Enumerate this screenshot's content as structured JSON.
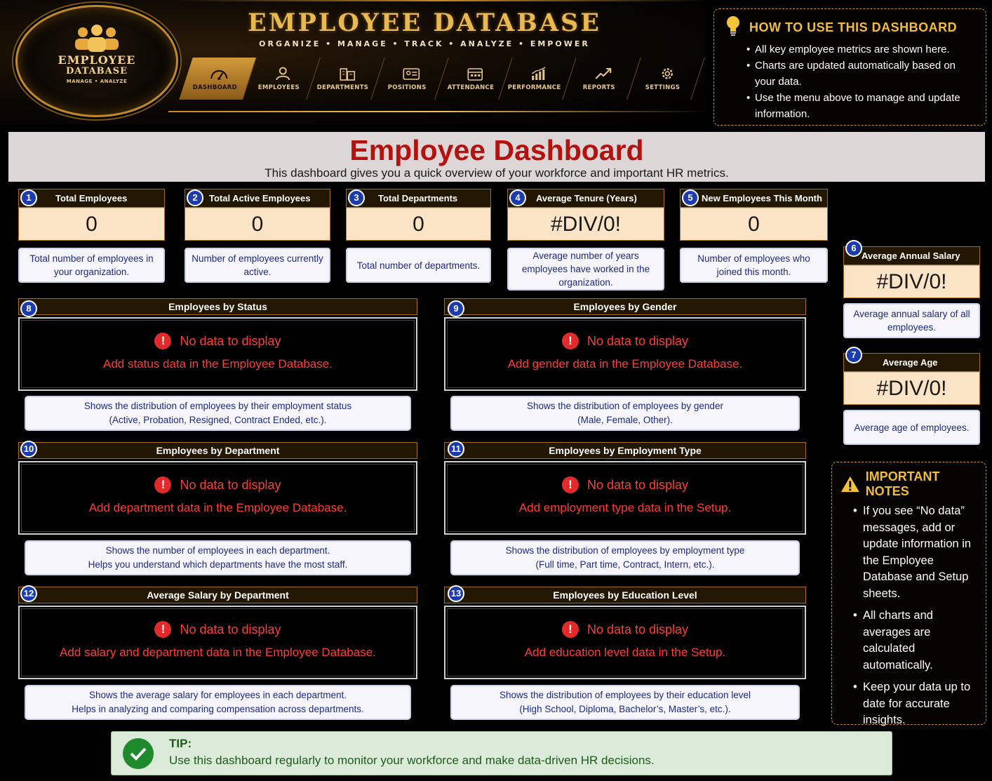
{
  "header": {
    "logo": {
      "line1": "EMPLOYEE",
      "line2": "DATABASE",
      "line3": "MANAGE • ANALYZE"
    },
    "title": "EMPLOYEE DATABASE",
    "subtitle": "ORGANIZE • MANAGE • TRACK • ANALYZE • EMPOWER",
    "nav": [
      {
        "label": "DASHBOARD",
        "icon": "gauge-icon",
        "active": true
      },
      {
        "label": "EMPLOYEES",
        "icon": "person-icon",
        "active": false
      },
      {
        "label": "DEPARTMENTS",
        "icon": "building-icon",
        "active": false
      },
      {
        "label": "POSITIONS",
        "icon": "id-card-icon",
        "active": false
      },
      {
        "label": "ATTENDANCE",
        "icon": "calendar-icon",
        "active": false
      },
      {
        "label": "PERFORMANCE",
        "icon": "bar-chart-icon",
        "active": false
      },
      {
        "label": "REPORTS",
        "icon": "trend-icon",
        "active": false
      },
      {
        "label": "SETTINGS",
        "icon": "gear-icon",
        "active": false
      }
    ]
  },
  "howto": {
    "title": "HOW TO USE THIS DASHBOARD",
    "items": [
      "All key employee metrics are shown here.",
      "Charts are updated automatically based on your data.",
      "Use the menu above to manage and update information."
    ]
  },
  "banner": {
    "title": "Employee Dashboard",
    "subtitle": "This dashboard gives you a quick overview of your workforce and important HR metrics."
  },
  "kpis": [
    {
      "num": "1",
      "title": "Total Employees",
      "value": "0",
      "desc": "Total number of employees in your organization."
    },
    {
      "num": "2",
      "title": "Total Active Employees",
      "value": "0",
      "desc": "Number of employees currently active."
    },
    {
      "num": "3",
      "title": "Total Departments",
      "value": "0",
      "desc": "Total number of departments."
    },
    {
      "num": "4",
      "title": "Average Tenure (Years)",
      "value": "#DIV/0!",
      "desc": "Average number of years employees have worked in the organization."
    },
    {
      "num": "5",
      "title": "New Employees This Month",
      "value": "0",
      "desc": "Number of employees who joined this month."
    },
    {
      "num": "6",
      "title": "Average Annual Salary",
      "value": "#DIV/0!",
      "desc": "Average annual salary of all employees."
    },
    {
      "num": "7",
      "title": "Average Age",
      "value": "#DIV/0!",
      "desc": "Average age of employees."
    }
  ],
  "panels": [
    {
      "num": "8",
      "title": "Employees by Status",
      "nodata": "No data to display",
      "hint": "Add status data in the Employee Database.",
      "desc1": "Shows the distribution of employees by their employment status",
      "desc2": "(Active, Probation, Resigned, Contract Ended, etc.)."
    },
    {
      "num": "9",
      "title": "Employees by Gender",
      "nodata": "No data to display",
      "hint": "Add gender data in the Employee Database.",
      "desc1": "Shows the distribution of employees by gender",
      "desc2": "(Male, Female, Other)."
    },
    {
      "num": "10",
      "title": "Employees by Department",
      "nodata": "No data to display",
      "hint": "Add department data in the Employee Database.",
      "desc1": "Shows the number of employees in each department.",
      "desc2": "Helps you understand which departments have the most staff."
    },
    {
      "num": "11",
      "title": "Employees by Employment Type",
      "nodata": "No data to display",
      "hint": "Add employment type data in the Setup.",
      "desc1": "Shows the distribution of employees by employment type",
      "desc2": "(Full time, Part time, Contract, Intern, etc.)."
    },
    {
      "num": "12",
      "title": "Average Salary by Department",
      "nodata": "No data to display",
      "hint": "Add salary and department data in the Employee Database.",
      "desc1": "Shows the average salary for employees in each department.",
      "desc2": "Helps in analyzing and comparing compensation across departments."
    },
    {
      "num": "13",
      "title": "Employees by Education Level",
      "nodata": "No data to display",
      "hint": "Add education level data in the Setup.",
      "desc1": "Shows the distribution of employees by their education level",
      "desc2": "(High School, Diploma, Bachelor’s, Master’s, etc.)."
    }
  ],
  "notes": {
    "title": "IMPORTANT NOTES",
    "items": [
      "If you see “No data” messages, add or update information in the Employee Database and Setup sheets.",
      "All charts and averages are calculated automatically.",
      "Keep your data up to date for accurate insights."
    ]
  },
  "tip": {
    "title": "TIP:",
    "text": "Use this dashboard regularly to monitor your workforce and make data-driven HR decisions."
  },
  "colors": {
    "accent_gold": "#c8911f",
    "card_header": "#231704",
    "value_bg": "#fbe3c6",
    "badge_blue": "#1c3cae",
    "error_red": "#ff3b3b",
    "title_red": "#b3120f",
    "tip_green": "#1f8a2c"
  }
}
